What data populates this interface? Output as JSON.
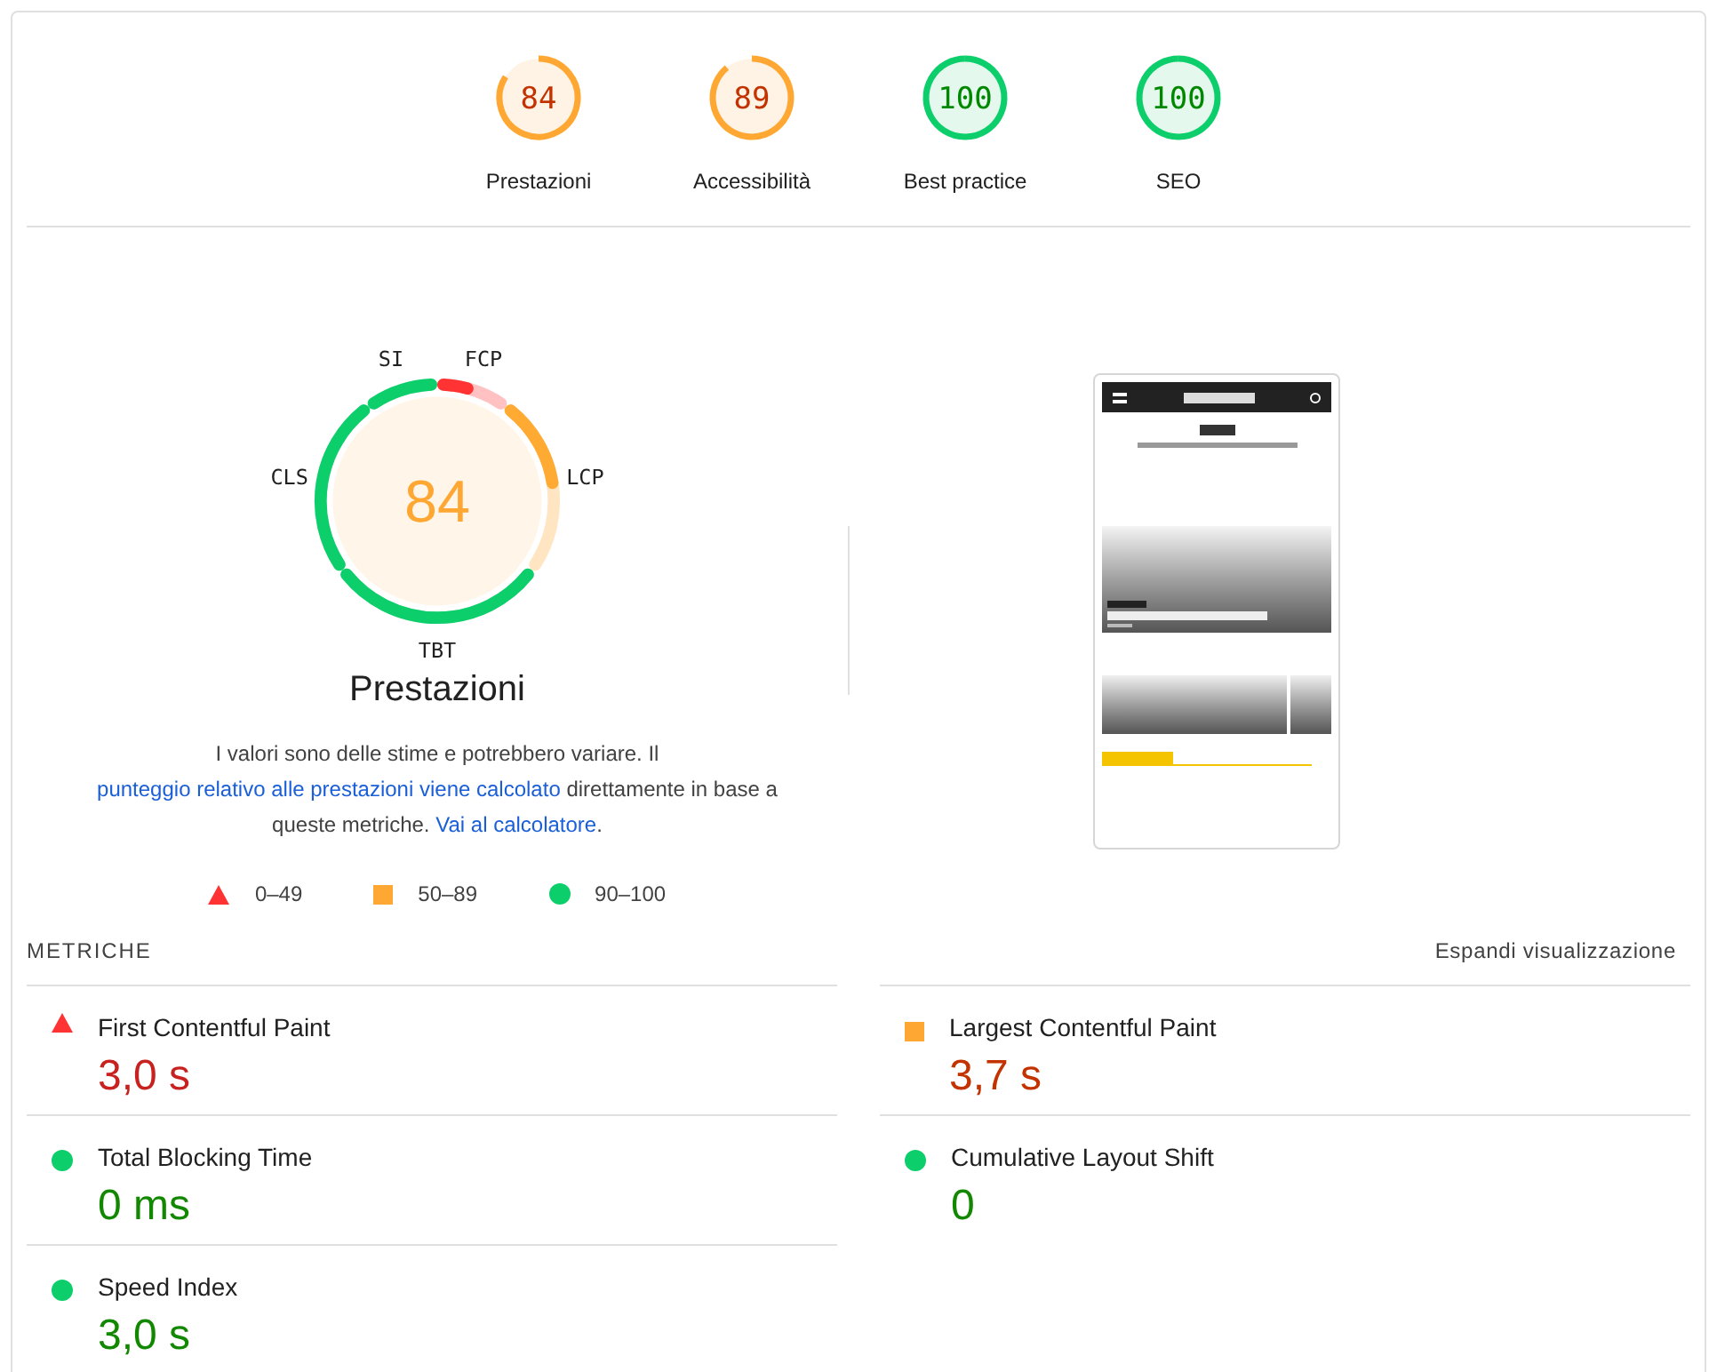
{
  "categories": [
    {
      "score": "84",
      "label": "Prestazioni",
      "level": 0.84,
      "kind": "average"
    },
    {
      "score": "89",
      "label": "Accessibilità",
      "level": 0.89,
      "kind": "average"
    },
    {
      "score": "100",
      "label": "Best practice",
      "level": 1,
      "kind": "pass"
    },
    {
      "score": "100",
      "label": "SEO",
      "level": 1,
      "kind": "pass"
    }
  ],
  "gauge": {
    "score": "84",
    "title": "Prestazioni",
    "kind": "average",
    "segments": [
      {
        "label": "FCP",
        "level": 0.4,
        "color": "#ff3333"
      },
      {
        "label": "LCP",
        "level": 0.5,
        "color": "#ffaa33"
      },
      {
        "label": "TBT",
        "level": 1,
        "color": "#0cce6b"
      },
      {
        "label": "CLS",
        "level": 1,
        "color": "#0cce6b"
      },
      {
        "label": "SI",
        "level": 1,
        "color": "#0cce6b"
      }
    ]
  },
  "description": [
    {
      "kind": "text",
      "text": "I valori sono delle stime e potrebbero variare. Il"
    },
    {
      "kind": "link",
      "text": "punteggio relativo alle prestazioni viene calcolato"
    },
    {
      "kind": "text",
      "text": "direttamente in base a queste metriche."
    },
    {
      "kind": "link",
      "text": "Vai al calcolatore"
    },
    {
      "kind": "text",
      "text": "."
    }
  ],
  "legend": [
    {
      "kind": "fail",
      "label": "0–49"
    },
    {
      "kind": "average",
      "label": "50–89"
    },
    {
      "kind": "pass",
      "label": "90–100"
    }
  ],
  "metrics_header": {
    "title": "METRICHE",
    "toggle": "Espandi visualizzazione"
  },
  "metrics": [
    {
      "name": "First Contentful Paint",
      "value": "3,0 s",
      "kind": "fail"
    },
    {
      "name": "Largest Contentful Paint",
      "value": "3,7 s",
      "kind": "average"
    },
    {
      "name": "Total Blocking Time",
      "value": "0 ms",
      "kind": "pass"
    },
    {
      "name": "Cumulative Layout Shift",
      "value": "0",
      "kind": "pass"
    },
    {
      "name": "Speed Index",
      "value": "3,0 s",
      "kind": "pass"
    }
  ]
}
